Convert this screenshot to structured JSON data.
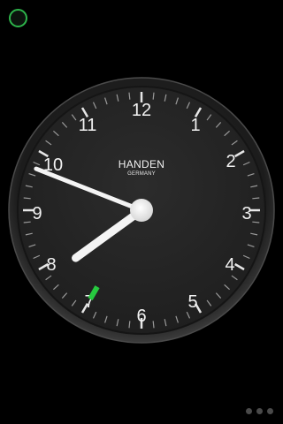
{
  "clock": {
    "brand": "HANDEN",
    "country": "GERMANY",
    "numbers": [
      "12",
      "1",
      "2",
      "3",
      "4",
      "5",
      "6",
      "7",
      "8",
      "9",
      "10",
      "11"
    ],
    "time": {
      "hour": 7,
      "minute": 48,
      "second": 35
    },
    "second_hand_color": "#27c93f"
  },
  "status_indicator": {
    "color": "#2db34a"
  },
  "page_indicator": {
    "count": 3
  }
}
